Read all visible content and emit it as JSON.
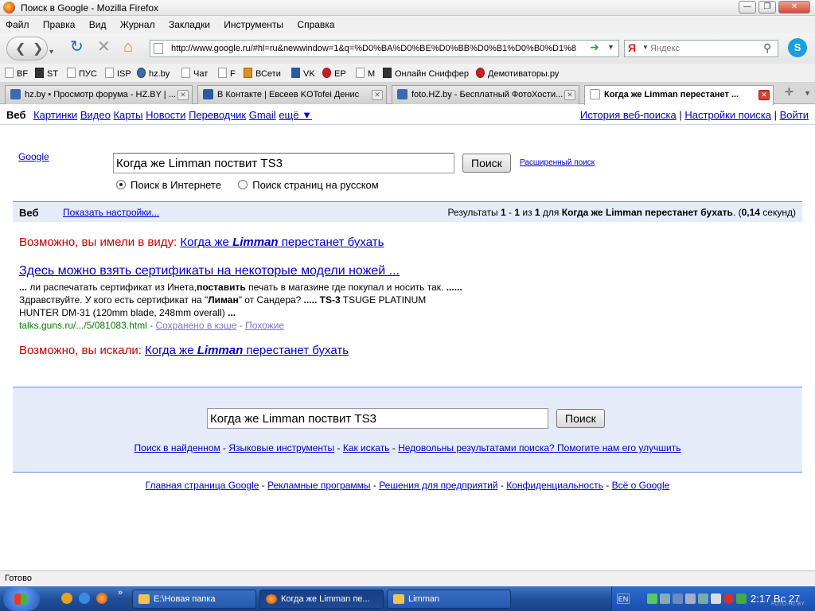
{
  "window": {
    "title": "Поиск в Google - Mozilla Firefox"
  },
  "menu": [
    "Файл",
    "Правка",
    "Вид",
    "Журнал",
    "Закладки",
    "Инструменты",
    "Справка"
  ],
  "navbar": {
    "url": "http://www.google.ru/#hl=ru&newwindow=1&q=%D0%BA%D0%BE%D0%BB%D0%B1%D0%B0%D1%8",
    "search_engine_letter": "Я",
    "search_placeholder": "Яндекс"
  },
  "bookmarks": [
    "BF",
    "ST",
    "ПУС",
    "ISP",
    "hz.by",
    "Чат",
    "F",
    "ВСети",
    "VK",
    "EP",
    "M",
    "Онлайн Сниффер",
    "Демотиваторы.ру"
  ],
  "tabs": [
    {
      "label": "hz.by • Просмотр форума - HZ.BY | ..."
    },
    {
      "label": "В Контакте | Евсеев KOTofei Денис"
    },
    {
      "label": "foto.HZ.by - Бесплатный ФотоХости..."
    },
    {
      "label": "Когда же Limman перестанет ..."
    }
  ],
  "gbar": {
    "items": [
      "Веб",
      "Картинки",
      "Видео",
      "Карты",
      "Новости",
      "Переводчик",
      "Gmail",
      "ещё ▼"
    ],
    "right": [
      "История веб-поиска",
      "Настройки поиска",
      "Войти"
    ],
    "sep": "|"
  },
  "search": {
    "logo_link": "Google",
    "query": "Когда же Limman поствит TS3",
    "button": "Поиск",
    "advanced": "Расширенный поиск",
    "radio1": "Поиск в Интернете",
    "radio2": "Поиск страниц на русском"
  },
  "results_bar": {
    "section": "Веб",
    "settings_link": "Показать настройки...",
    "stats_prefix": "Результаты ",
    "stats_range_start": "1",
    "stats_dash": " - ",
    "stats_range_end": "1",
    "stats_of": " из ",
    "stats_total": "1",
    "stats_for": " для ",
    "stats_query": "Когда же Limman перестанет бухать",
    "stats_paren_open": ". (",
    "stats_time": "0,14",
    "stats_seconds": " секунд)"
  },
  "did_you_mean": {
    "label": "Возможно, вы имели в виду:",
    "link_pre": "Когда же ",
    "link_bold": "Limman",
    "link_post": " перестанет бухать"
  },
  "result": {
    "title": "Здесь можно взять сертификаты на некоторые модели ножей ...",
    "snip1": "... ",
    "snip2": "ли распечатать сертификат из Инета,",
    "snip3": "поставить",
    "snip4": " печать в магазине где покупал и носить так. ",
    "snip5": "......",
    "snip6": " Здравствуйте. У кого есть сертификат на \"",
    "snip7": "Лиман",
    "snip8": "\" от Сандера? ",
    "snip9": "..... TS-3",
    "snip10": " TSUGE PLATINUM HUNTER DM-31 (120mm blade, 248mm overall) ",
    "snip11": "...",
    "url": "talks.guns.ru/.../5/081083.html",
    "cached": "Сохранено в кэше",
    "similar": "Похожие",
    "dash": " - "
  },
  "did_you_search": {
    "label": "Возможно, вы искали:",
    "link_pre": "Когда же ",
    "link_bold": "Limman",
    "link_post": " перестанет бухать"
  },
  "footer": {
    "query": "Когда же Limman поствит TS3",
    "button": "Поиск",
    "links1": [
      "Поиск в найденном",
      "Языковые инструменты",
      "Как искать",
      "Недовольны результатами поиска? Помогите нам его улучшить"
    ],
    "links2": [
      "Главная страница Google",
      "Рекламные программы",
      "Решения для предприятий",
      "Конфиденциальность",
      "Всё о Google"
    ],
    "dash": " - "
  },
  "status": "Готово",
  "taskbar": {
    "items": [
      "E:\\Новая папка",
      "Когда же Limman пе...",
      "Limman"
    ],
    "lang": "EN",
    "clock": "2:17 Вс 27",
    "watermark": "FOTO.HZ.BY",
    "more": "»"
  },
  "colors": {
    "link": "#0000cc",
    "dym": "#cc0000",
    "url_green": "#008000",
    "bar_blue": "#e5ecf9"
  }
}
